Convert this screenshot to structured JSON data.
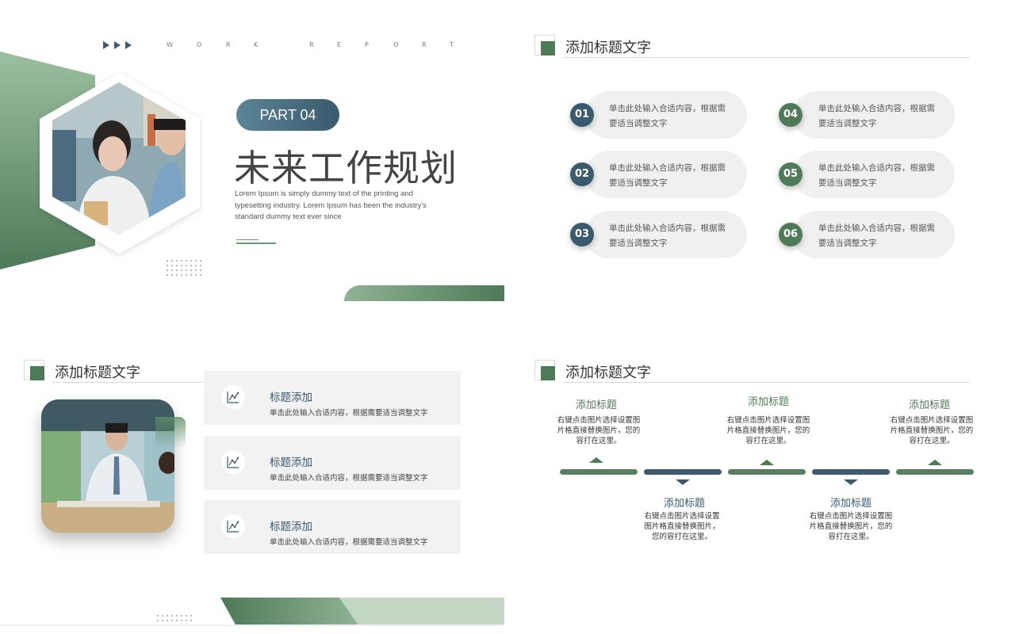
{
  "colors": {
    "green": "#4f7a58",
    "blue": "#3a5a6d",
    "light_gray": "#f0f0f0"
  },
  "slide1": {
    "work_report_letters": [
      "W",
      "O",
      "R",
      "K",
      "R",
      "E",
      "P",
      "O",
      "R",
      "T"
    ],
    "part_label": "PART 04",
    "title": "未来工作规划",
    "lorem": "Lorem Ipsum is simply dummy text of the printing and typesetting industry. Lorem Ipsum has been the industry's standard dummy text ever since"
  },
  "slide2": {
    "header_title": "添加标题文字",
    "items": [
      {
        "num": "01",
        "text": "单击此处输入合适内容，根据需要适当调整文字"
      },
      {
        "num": "02",
        "text": "单击此处输入合适内容，根据需要适当调整文字"
      },
      {
        "num": "03",
        "text": "单击此处输入合适内容，根据需要适当调整文字"
      },
      {
        "num": "04",
        "text": "单击此处输入合适内容，根据需要适当调整文字"
      },
      {
        "num": "05",
        "text": "单击此处输入合适内容，根据需要适当调整文字"
      },
      {
        "num": "06",
        "text": "单击此处输入合适内容，根据需要适当调整文字"
      }
    ]
  },
  "slide3": {
    "header_title": "添加标题文字",
    "rows": [
      {
        "icon": "chart-icon",
        "title": "标题添加",
        "desc": "单击此处输入合适内容，根据需要适当调整文字"
      },
      {
        "icon": "chart-icon",
        "title": "标题添加",
        "desc": "单击此处输入合适内容，根据需要适当调整文字"
      },
      {
        "icon": "chart-icon",
        "title": "标题添加",
        "desc": "单击此处输入合适内容，根据需要适当调整文字"
      }
    ]
  },
  "slide4": {
    "header_title": "添加标题文字",
    "timeline": [
      {
        "title": "添加标题",
        "desc": "右键点击图片选择设置图片格直接替换图片，您的容打在这里。"
      },
      {
        "title": "添加标题",
        "desc": "右键点击图片选择设置图片格直接替换图片，您的容打在这里。"
      },
      {
        "title": "添加标题",
        "desc": "右键点击图片选择设置图片格直接替换图片，您的容打在这里。"
      },
      {
        "title": "添加标题",
        "desc": "右键点击图片选择设置图片格直接替换图片，您的容打在这里。"
      },
      {
        "title": "添加标题",
        "desc": "右键点击图片选择设置图片格直接替换图片，您的容打在这里。"
      }
    ]
  }
}
